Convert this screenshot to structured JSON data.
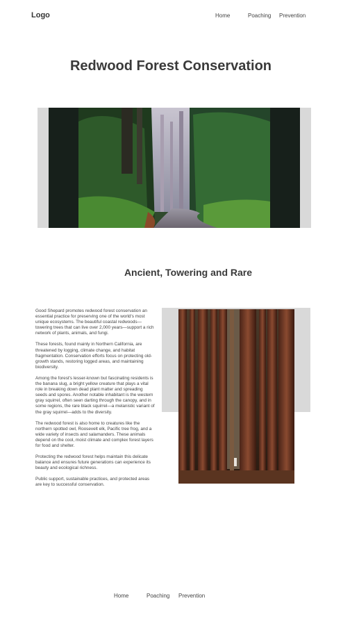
{
  "header": {
    "logo": "Logo",
    "nav": [
      {
        "label": "Home"
      },
      {
        "label": "Poaching"
      },
      {
        "label": "Prevention"
      }
    ]
  },
  "main": {
    "title": "Redwood Forest Conservation",
    "subtitle": "Ancient, Towering and Rare",
    "paragraphs": [
      "Good Shepard promotes redwood forest conservation an essential practice for preserving one of the world's most unique ecosystems. The beautiful coastal redwoods—towering trees that can live over 2,000 years—support a rich network of plants, animals, and fungi.",
      "These forests, found mainly in Northern California, are threatened by logging, climate change, and habitat fragmentation. Conservation efforts focus on protecting old-growth stands, restoring logged areas, and maintaining biodiversity.",
      "Among the forest's lesser-known but fascinating residents is the banana slug, a bright yellow creature that plays a vital role in breaking down dead plant matter and spreading seeds and spores. Another notable inhabitant is the western gray squirrel, often seen darting through the canopy, and in some regions, the rare black squirrel—a melanistic variant of the gray squirrel—adds to the diversity.",
      "The redwood forest is also home to creatures like the northern spotted owl, Roosevelt elk, Pacific tree frog, and a wide variety of insects and salamanders. These animals depend on the cool, moist climate and complex forest layers for food and shelter.",
      "Protecting the redwood forest helps maintain this delicate balance and ensures future generations can experience its beauty and ecological richness.",
      "Public support, sustainable practices, and protected areas are key to successful conservation."
    ]
  },
  "footer": {
    "nav": [
      {
        "label": "Home"
      },
      {
        "label": "Poaching"
      },
      {
        "label": "Prevention"
      }
    ]
  },
  "colors": {
    "frame": "#d9d9d9",
    "hero_backdrop": "#17201b",
    "text": "#444444"
  }
}
